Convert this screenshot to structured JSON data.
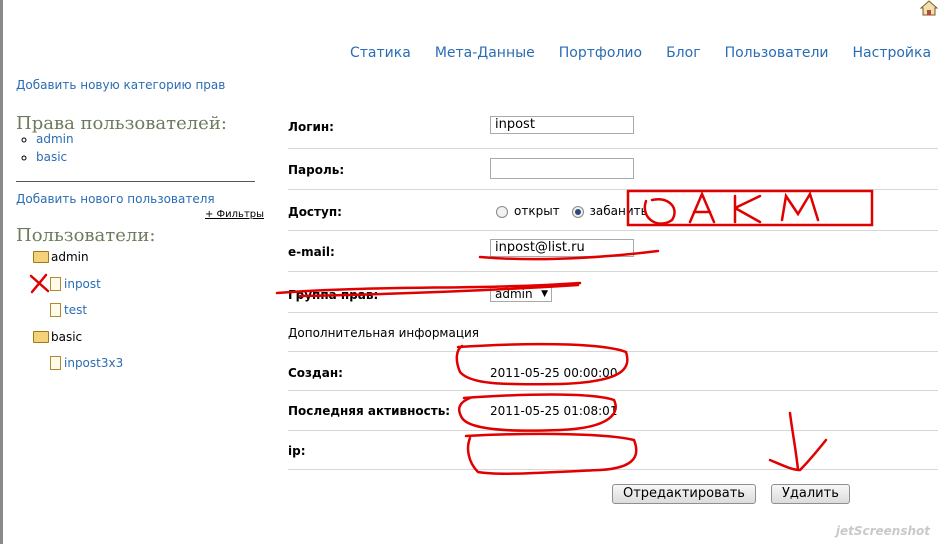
{
  "nav": [
    "Статика",
    "Мета-Данные",
    "Портфолио",
    "Блог",
    "Пользователи",
    "Настройка"
  ],
  "sidebar": {
    "add_category": "Добавить новую категорию прав",
    "rights_title": "Права пользователей:",
    "rights": [
      "admin",
      "basic"
    ],
    "add_user": "Добавить нового пользователя",
    "filters": "+ Фильтры",
    "users_title": "Пользователи:",
    "groups": [
      {
        "name": "admin",
        "users": [
          "inpost",
          "test"
        ]
      },
      {
        "name": "basic",
        "users": [
          "inpost3x3"
        ]
      }
    ]
  },
  "form": {
    "login_label": "Логин:",
    "login_value": "inpost",
    "password_label": "Пароль:",
    "access_label": "Доступ:",
    "access_open": "открыт",
    "access_banned": "забанить",
    "email_label": "e-mail:",
    "email_value": "inpost@list.ru",
    "group_label": "Группа прав:",
    "group_value": "admin",
    "extra_info": "Дополнительная информация",
    "created_label": "Создан:",
    "created_value": "2011-05-25 00:00:00",
    "last_active_label": "Последняя активность:",
    "last_active_value": "2011-05-25 01:08:01",
    "ip_label": "ip:"
  },
  "buttons": {
    "edit": "Отредактировать",
    "delete": "Удалить"
  },
  "watermark": "jetScreenshot"
}
